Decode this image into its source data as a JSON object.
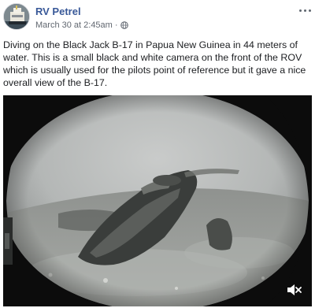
{
  "post": {
    "author": "RV Petrel",
    "timestamp": "March 30 at 2:45am",
    "separator": "·",
    "text": "Diving on the Black Jack B-17 in Papua New Guinea in 44 meters of water. This is a small black and white camera on the front of the ROV which is usually used for the pilots point of reference but it gave a nice overall view of the B-17.",
    "privacy_icon": "globe-icon",
    "menu_icon": "more-options-icon"
  },
  "video": {
    "description_icon": "sound-muted-icon",
    "colors": {
      "water": "#b9bcbb",
      "seafloor": "#9a9d99",
      "frame": "#0c0c0c"
    }
  },
  "colors": {
    "author_link": "#385898",
    "meta_text": "#616770",
    "body_text": "#1c1e21"
  }
}
